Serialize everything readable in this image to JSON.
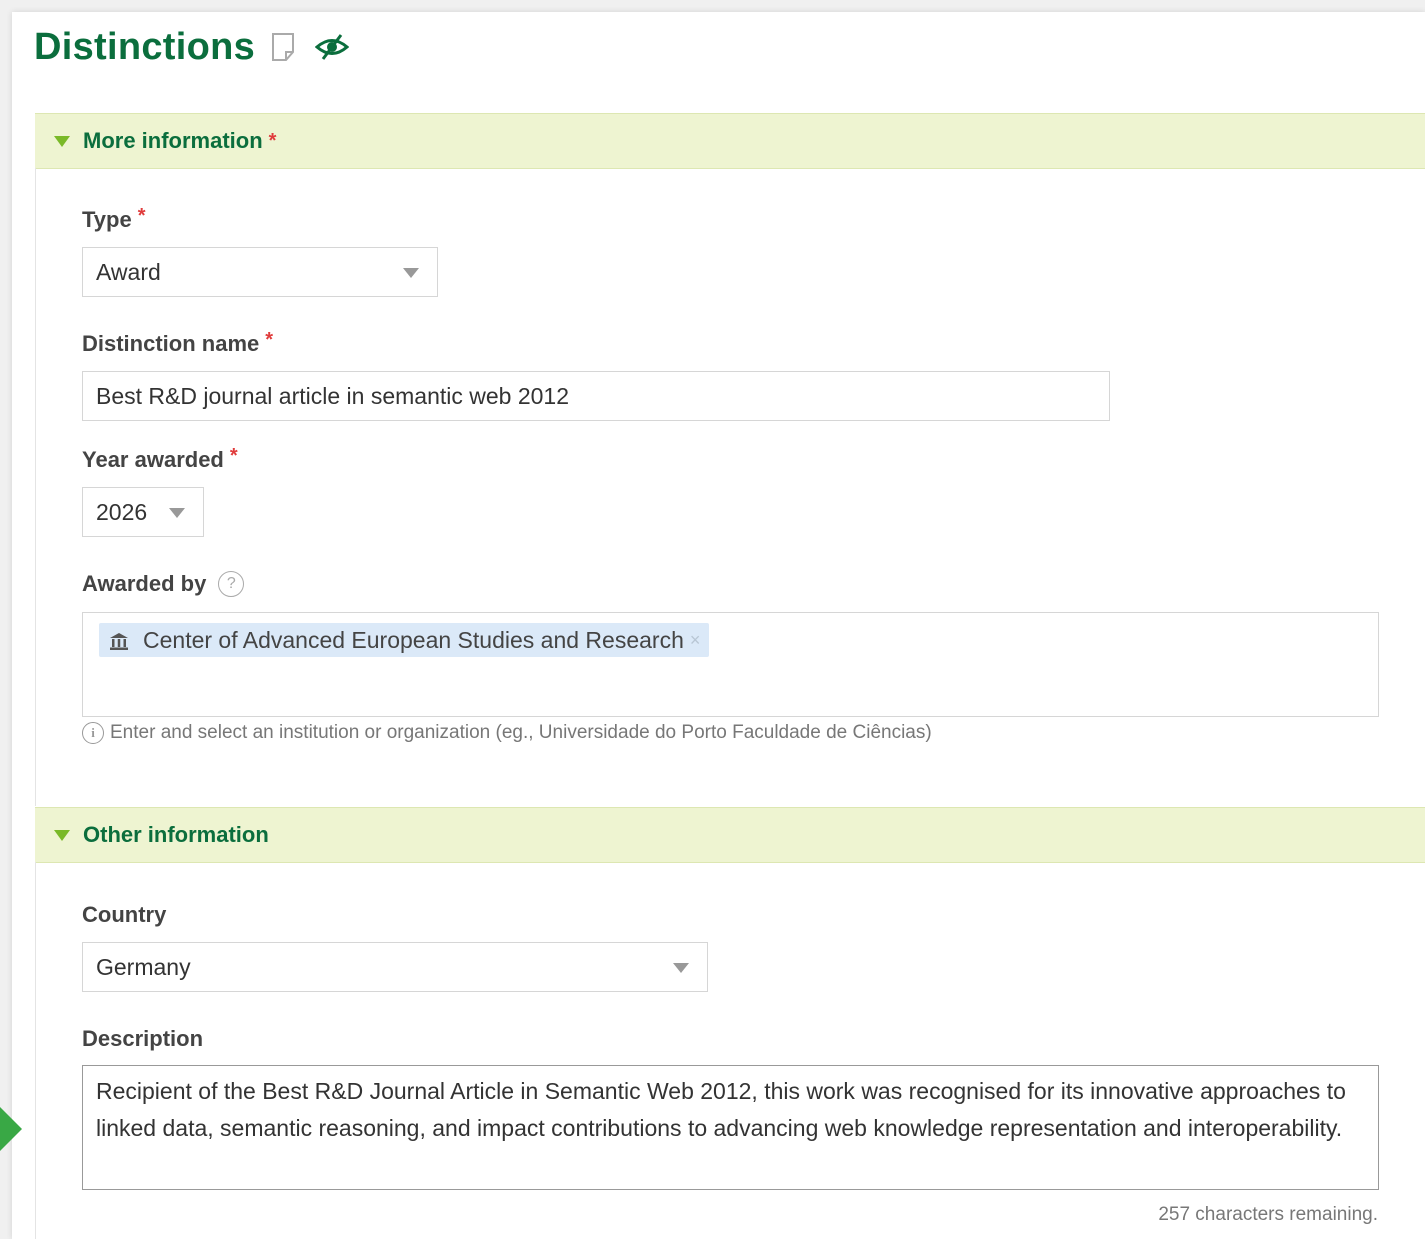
{
  "page": {
    "title": "Distinctions"
  },
  "section_more": {
    "label": "More information",
    "required_mark": "*"
  },
  "type_field": {
    "label": "Type",
    "required_mark": "*",
    "value": "Award"
  },
  "distinction_name": {
    "label": "Distinction name",
    "required_mark": "*",
    "value": "Best R&D journal article in semantic web 2012"
  },
  "year_awarded": {
    "label": "Year awarded",
    "required_mark": "*",
    "value": "2026"
  },
  "awarded_by": {
    "label": "Awarded by",
    "help_glyph": "?",
    "tag": "Center of Advanced European Studies and Research",
    "tag_remove_glyph": "×",
    "hint_glyph": "i",
    "hint": "Enter and select an institution or organization (eg., Universidade do Porto Faculdade de Ciências)"
  },
  "section_other": {
    "label": "Other information"
  },
  "country": {
    "label": "Country",
    "value": "Germany"
  },
  "description": {
    "label": "Description",
    "value": "Recipient of the Best R&D Journal Article in Semantic Web 2012, this work was recognised for its innovative approaches to linked data, semantic reasoning, and impact contributions to advancing web knowledge representation and interoperability.",
    "counter": "257 characters remaining."
  },
  "colors": {
    "title_green": "#0b6e3d",
    "section_bg": "#eef4d1",
    "caret_green": "#7ab928",
    "required_red": "#e03c3c",
    "tag_bg": "#dbe9f8",
    "side_arrow": "#39a845"
  },
  "icons": {
    "doc": "document-icon",
    "visibility": "eye-icon",
    "caret": "caret-down-icon",
    "help": "help-circle-icon",
    "institution": "bank-icon",
    "info": "info-circle-icon"
  }
}
